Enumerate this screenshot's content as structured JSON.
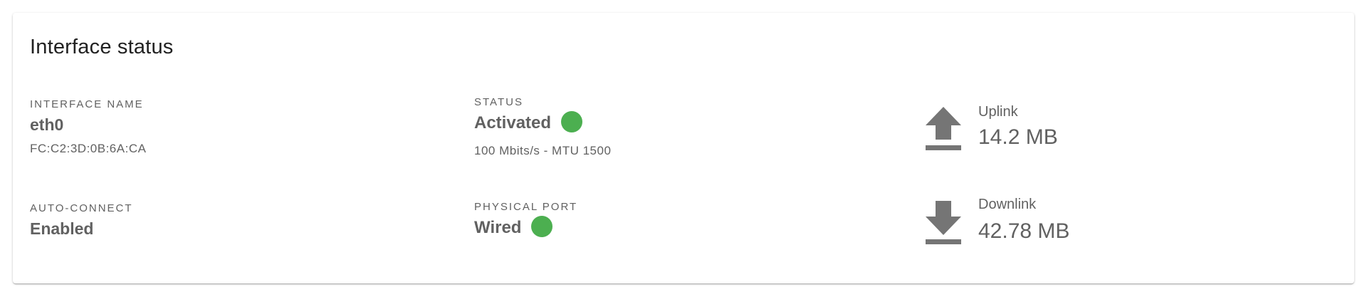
{
  "card": {
    "title": "Interface status"
  },
  "interface": {
    "name_label": "INTERFACE NAME",
    "name": "eth0",
    "mac": "FC:C2:3D:0B:6A:CA",
    "autoconnect_label": "AUTO-CONNECT",
    "autoconnect": "Enabled"
  },
  "status": {
    "label": "STATUS",
    "value": "Activated",
    "indicator_icon": "status-dot",
    "indicator_color": "#4caf50",
    "detail": "100 Mbits/s - MTU 1500"
  },
  "port": {
    "label": "PHYSICAL PORT",
    "value": "Wired",
    "indicator_icon": "status-dot",
    "indicator_color": "#4caf50"
  },
  "traffic": {
    "uplink_label": "Uplink",
    "uplink_value": "14.2 MB",
    "uplink_icon": "upload-icon",
    "downlink_label": "Downlink",
    "downlink_value": "42.78 MB",
    "downlink_icon": "download-icon",
    "icon_color": "#757575"
  }
}
